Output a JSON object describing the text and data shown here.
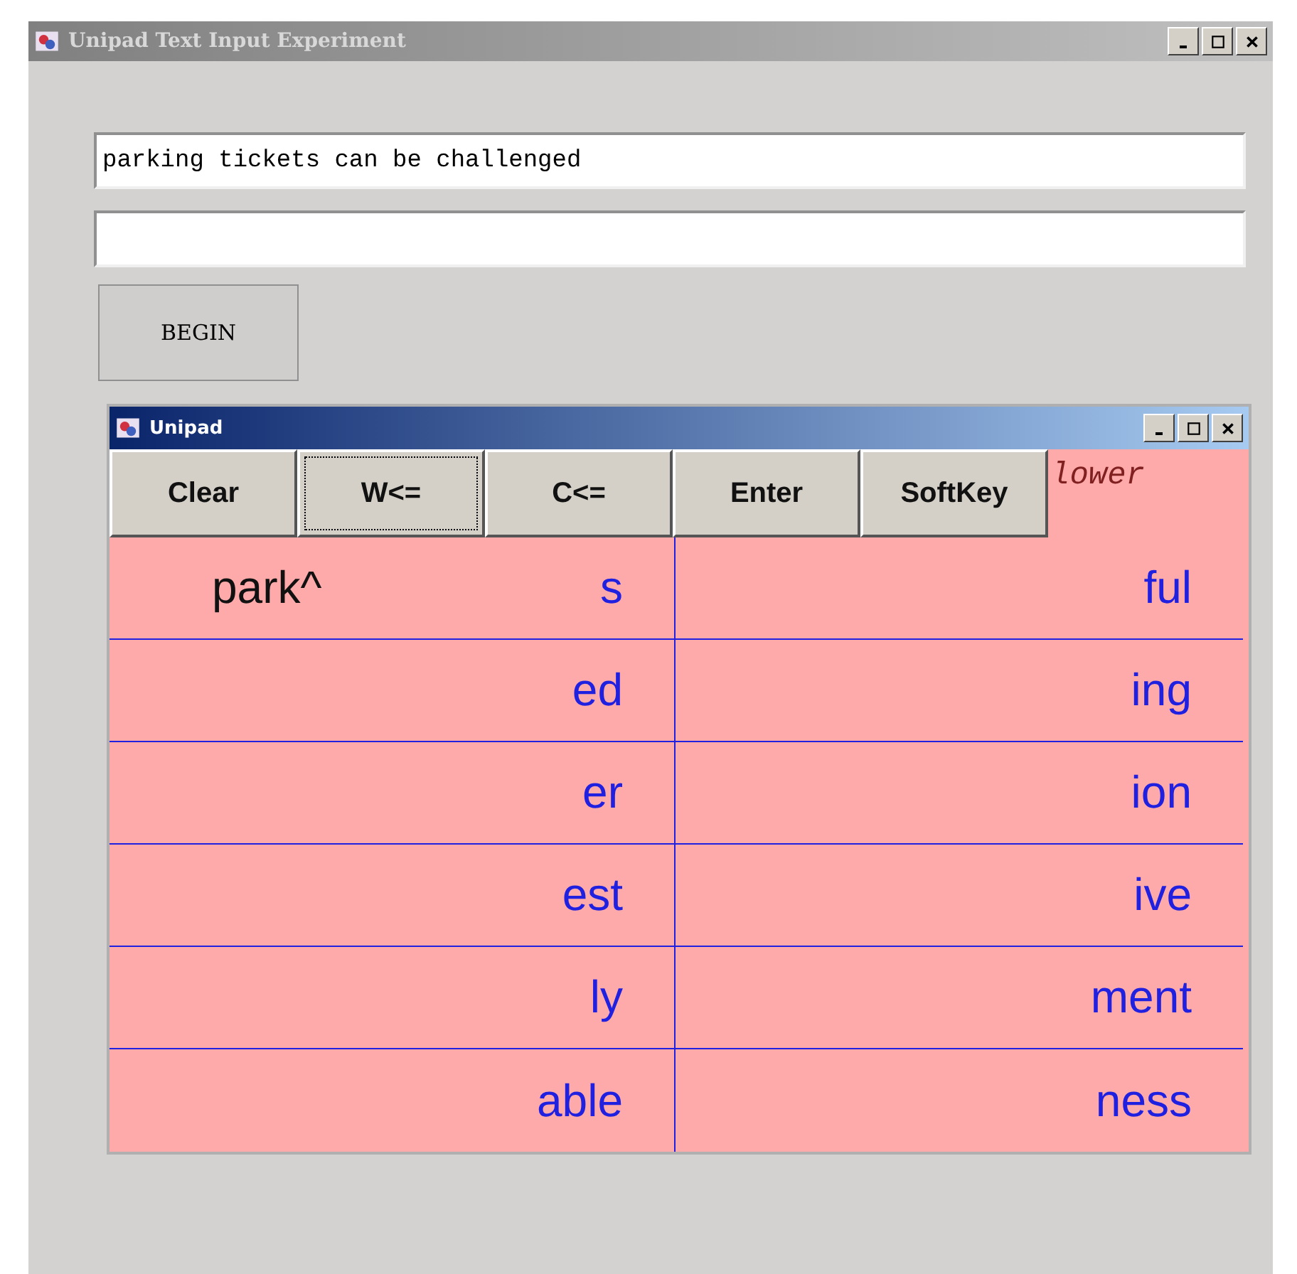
{
  "window": {
    "title": "Unipad Text Input Experiment",
    "active": false
  },
  "target_field": {
    "value": "parking tickets can be challenged"
  },
  "begin_button": {
    "label": "BEGIN"
  },
  "unipad": {
    "title": "Unipad",
    "active": true,
    "buttons": [
      {
        "label": "Clear",
        "focused": false
      },
      {
        "label": "W<=",
        "focused": true
      },
      {
        "label": "C<=",
        "focused": false
      },
      {
        "label": "Enter",
        "focused": false
      },
      {
        "label": "SoftKey",
        "focused": false
      }
    ],
    "mode": "lower",
    "rows": [
      [
        {
          "stem": "park^",
          "suffix": "s"
        },
        {
          "suffix": "ful"
        }
      ],
      [
        {
          "suffix": "ed"
        },
        {
          "suffix": "ing"
        }
      ],
      [
        {
          "suffix": "er"
        },
        {
          "suffix": "ion"
        }
      ],
      [
        {
          "suffix": "est"
        },
        {
          "suffix": "ive"
        }
      ],
      [
        {
          "suffix": "ly"
        },
        {
          "suffix": "ment"
        }
      ],
      [
        {
          "suffix": "able"
        },
        {
          "suffix": "ness"
        }
      ]
    ]
  }
}
